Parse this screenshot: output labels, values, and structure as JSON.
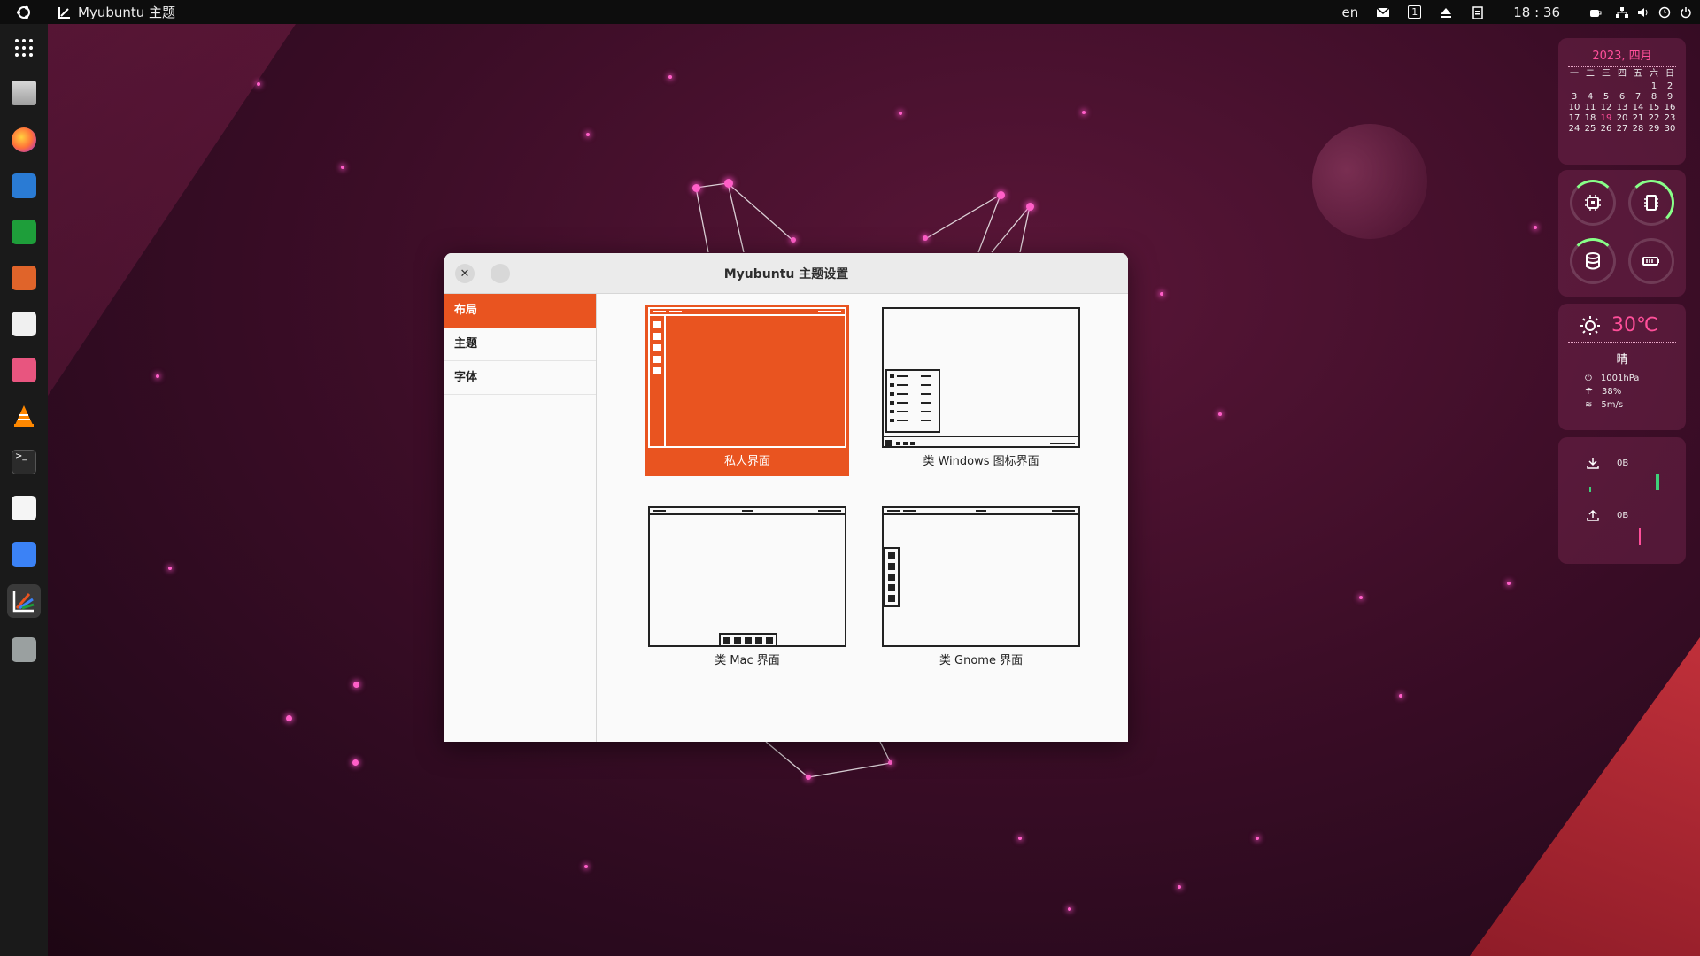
{
  "topbar": {
    "app_title": "Myubuntu 主题",
    "language": "en",
    "workspace": "1",
    "clock": "18 : 36"
  },
  "dock": {
    "items": [
      {
        "name": "app-grid",
        "color": "#ffffff"
      },
      {
        "name": "files",
        "color": "#c9c9c9"
      },
      {
        "name": "firefox",
        "color": "#ff7139"
      },
      {
        "name": "libreoffice-writer",
        "color": "#2a7bd4"
      },
      {
        "name": "libreoffice-calc",
        "color": "#1e9e3a"
      },
      {
        "name": "libreoffice-impress",
        "color": "#e0642a"
      },
      {
        "name": "software-store",
        "color": "#f0f0f0"
      },
      {
        "name": "installer",
        "color": "#e8557f"
      },
      {
        "name": "vlc",
        "color": "#ff8800"
      },
      {
        "name": "terminal",
        "color": "#2b2b2b"
      },
      {
        "name": "text-editor",
        "color": "#f5f5f5"
      },
      {
        "name": "screenshot",
        "color": "#3b82f6"
      },
      {
        "name": "myubuntu-theme",
        "color": "#e95420"
      },
      {
        "name": "trash",
        "color": "#9aa0a0"
      }
    ]
  },
  "window": {
    "title": "Myubuntu 主题设置",
    "close_label": "✕",
    "minimize_label": "–",
    "sidebar": [
      {
        "label": "布局",
        "selected": true
      },
      {
        "label": "主题",
        "selected": false
      },
      {
        "label": "字体",
        "selected": false
      }
    ],
    "layouts": [
      {
        "label": "私人界面",
        "selected": true
      },
      {
        "label": "类 Windows 图标界面",
        "selected": false
      },
      {
        "label": "类 Mac 界面",
        "selected": false
      },
      {
        "label": "类 Gnome 界面",
        "selected": false
      }
    ]
  },
  "widgets": {
    "calendar": {
      "title": "2023, 四月",
      "weekdays": [
        "一",
        "二",
        "三",
        "四",
        "五",
        "六",
        "日"
      ],
      "weeks": [
        [
          "",
          "",
          "",
          "",
          "",
          "1",
          "2"
        ],
        [
          "3",
          "4",
          "5",
          "6",
          "7",
          "8",
          "9"
        ],
        [
          "10",
          "11",
          "12",
          "13",
          "14",
          "15",
          "16"
        ],
        [
          "17",
          "18",
          "19",
          "20",
          "21",
          "22",
          "23"
        ],
        [
          "24",
          "25",
          "26",
          "27",
          "28",
          "29",
          "30"
        ]
      ],
      "today": "19"
    },
    "system": {
      "cpu_icon": "cpu-icon",
      "memory_icon": "memory-icon",
      "disk_icon": "disk-icon",
      "battery_icon": "battery-icon"
    },
    "weather": {
      "temperature": "30℃",
      "condition": "晴",
      "pressure": "1001hPa",
      "humidity": "38%",
      "wind": "5m/s"
    },
    "network": {
      "download": "0B",
      "upload": "0B"
    }
  },
  "colors": {
    "accent": "#e95420",
    "highlight": "#ff4f9a"
  }
}
